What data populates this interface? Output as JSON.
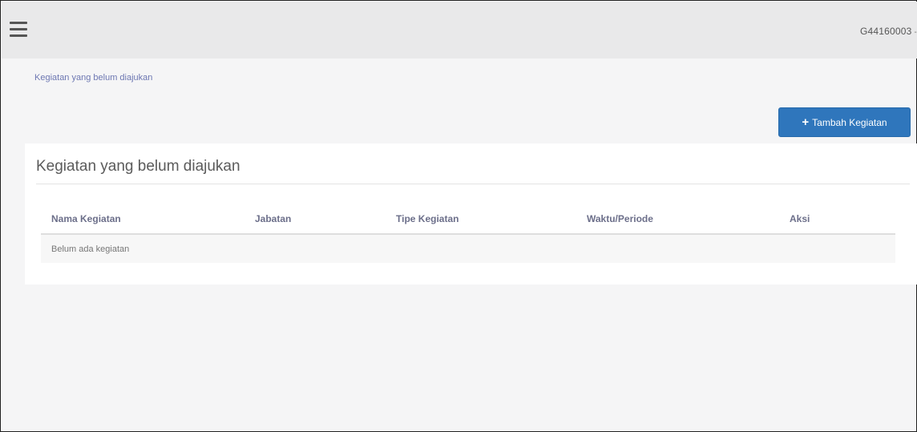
{
  "header": {
    "menu_icon": "hamburger-icon",
    "user": "G44160003",
    "user_caret": "-"
  },
  "breadcrumb": "Kegiatan yang belum diajukan",
  "toolbar": {
    "add_icon": "plus-icon",
    "add_label": "Tambah Kegiatan",
    "add_color": "#2f76bc"
  },
  "panel": {
    "title": "Kegiatan yang belum diajukan",
    "table": {
      "columns": [
        "Nama Kegiatan",
        "Jabatan",
        "Tipe Kegiatan",
        "Waktu/Periode",
        "Aksi"
      ],
      "empty_message": "Belum ada kegiatan"
    }
  }
}
